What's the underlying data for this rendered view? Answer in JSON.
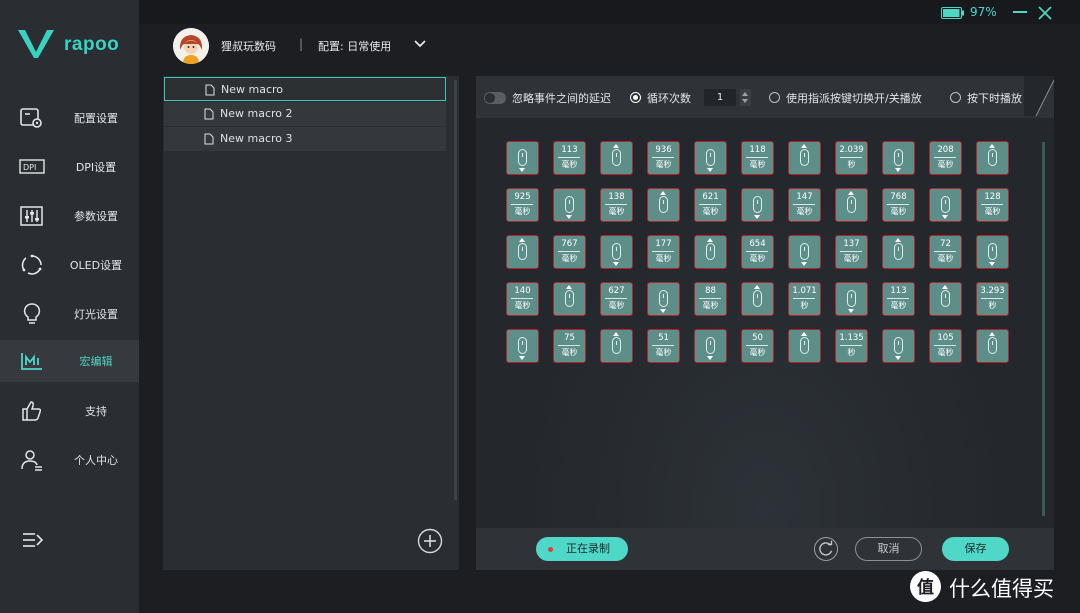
{
  "brand": {
    "name": "rapoo",
    "accent": "#4dd6c6"
  },
  "window": {
    "battery_percent": "97%",
    "battery_level": 0.97,
    "controls": [
      "minimize-icon",
      "close-icon"
    ]
  },
  "user": {
    "name": "狸叔玩数码"
  },
  "config": {
    "label": "配置: 日常使用"
  },
  "sidebar": {
    "items": [
      {
        "label": "配置设置",
        "icon": "config-icon"
      },
      {
        "label": "DPI设置",
        "icon": "dpi-icon"
      },
      {
        "label": "参数设置",
        "icon": "sliders-icon"
      },
      {
        "label": "OLED设置",
        "icon": "oled-icon"
      },
      {
        "label": "灯光设置",
        "icon": "lightbulb-icon"
      },
      {
        "label": "宏编辑",
        "icon": "macro-icon",
        "active": true
      },
      {
        "label": "支持",
        "icon": "thumbs-up-icon"
      },
      {
        "label": "个人中心",
        "icon": "user-icon"
      }
    ]
  },
  "macros": {
    "items": [
      {
        "label": "New macro",
        "selected": true
      },
      {
        "label": "New macro 2"
      },
      {
        "label": "New macro 3"
      }
    ]
  },
  "toolbar": {
    "ignore_delay_label": "忽略事件之间的延迟",
    "loop_label": "循环次数",
    "loop_count": "1",
    "toggle_play_label": "使用指派按键切换开/关播放",
    "hold_play_label": "按下时播放",
    "selected_mode": "loop"
  },
  "events": {
    "unit_ms": "毫秒",
    "unit_s": "秒",
    "rows": [
      [
        {
          "type": "mouse",
          "dir": "down"
        },
        {
          "type": "delay",
          "value": "113",
          "unit": "毫秒"
        },
        {
          "type": "mouse",
          "dir": "up"
        },
        {
          "type": "delay",
          "value": "936",
          "unit": "毫秒"
        },
        {
          "type": "mouse",
          "dir": "down"
        },
        {
          "type": "delay",
          "value": "118",
          "unit": "毫秒"
        },
        {
          "type": "mouse",
          "dir": "up"
        },
        {
          "type": "delay",
          "value": "2.039",
          "unit": "秒"
        },
        {
          "type": "mouse",
          "dir": "down"
        },
        {
          "type": "delay",
          "value": "208",
          "unit": "毫秒"
        },
        {
          "type": "mouse",
          "dir": "up"
        }
      ],
      [
        {
          "type": "delay",
          "value": "925",
          "unit": "毫秒"
        },
        {
          "type": "mouse",
          "dir": "down"
        },
        {
          "type": "delay",
          "value": "138",
          "unit": "毫秒"
        },
        {
          "type": "mouse",
          "dir": "up"
        },
        {
          "type": "delay",
          "value": "621",
          "unit": "毫秒"
        },
        {
          "type": "mouse",
          "dir": "down"
        },
        {
          "type": "delay",
          "value": "147",
          "unit": "毫秒"
        },
        {
          "type": "mouse",
          "dir": "up"
        },
        {
          "type": "delay",
          "value": "768",
          "unit": "毫秒"
        },
        {
          "type": "mouse",
          "dir": "down"
        },
        {
          "type": "delay",
          "value": "128",
          "unit": "毫秒"
        }
      ],
      [
        {
          "type": "mouse",
          "dir": "up"
        },
        {
          "type": "delay",
          "value": "767",
          "unit": "毫秒"
        },
        {
          "type": "mouse",
          "dir": "down"
        },
        {
          "type": "delay",
          "value": "177",
          "unit": "毫秒"
        },
        {
          "type": "mouse",
          "dir": "up"
        },
        {
          "type": "delay",
          "value": "654",
          "unit": "毫秒"
        },
        {
          "type": "mouse",
          "dir": "down"
        },
        {
          "type": "delay",
          "value": "137",
          "unit": "毫秒"
        },
        {
          "type": "mouse",
          "dir": "up"
        },
        {
          "type": "delay",
          "value": "72",
          "unit": "毫秒"
        },
        {
          "type": "mouse",
          "dir": "down"
        }
      ],
      [
        {
          "type": "delay",
          "value": "140",
          "unit": "毫秒"
        },
        {
          "type": "mouse",
          "dir": "up"
        },
        {
          "type": "delay",
          "value": "627",
          "unit": "毫秒"
        },
        {
          "type": "mouse",
          "dir": "down"
        },
        {
          "type": "delay",
          "value": "88",
          "unit": "毫秒"
        },
        {
          "type": "mouse",
          "dir": "up"
        },
        {
          "type": "delay",
          "value": "1.071",
          "unit": "秒"
        },
        {
          "type": "mouse",
          "dir": "down"
        },
        {
          "type": "delay",
          "value": "113",
          "unit": "毫秒"
        },
        {
          "type": "mouse",
          "dir": "up"
        },
        {
          "type": "delay",
          "value": "3.293",
          "unit": "秒"
        }
      ],
      [
        {
          "type": "mouse",
          "dir": "down"
        },
        {
          "type": "delay",
          "value": "75",
          "unit": "毫秒"
        },
        {
          "type": "mouse",
          "dir": "up"
        },
        {
          "type": "delay",
          "value": "51",
          "unit": "毫秒"
        },
        {
          "type": "mouse",
          "dir": "down"
        },
        {
          "type": "delay",
          "value": "50",
          "unit": "毫秒"
        },
        {
          "type": "mouse",
          "dir": "up"
        },
        {
          "type": "delay",
          "value": "1.135",
          "unit": "秒"
        },
        {
          "type": "mouse",
          "dir": "down"
        },
        {
          "type": "delay",
          "value": "105",
          "unit": "毫秒"
        },
        {
          "type": "mouse",
          "dir": "up"
        }
      ]
    ]
  },
  "bottom": {
    "record_label": "正在录制",
    "cancel_label": "取消",
    "save_label": "保存"
  },
  "watermark": {
    "text": "什么值得买",
    "logo_glyph": "值"
  }
}
